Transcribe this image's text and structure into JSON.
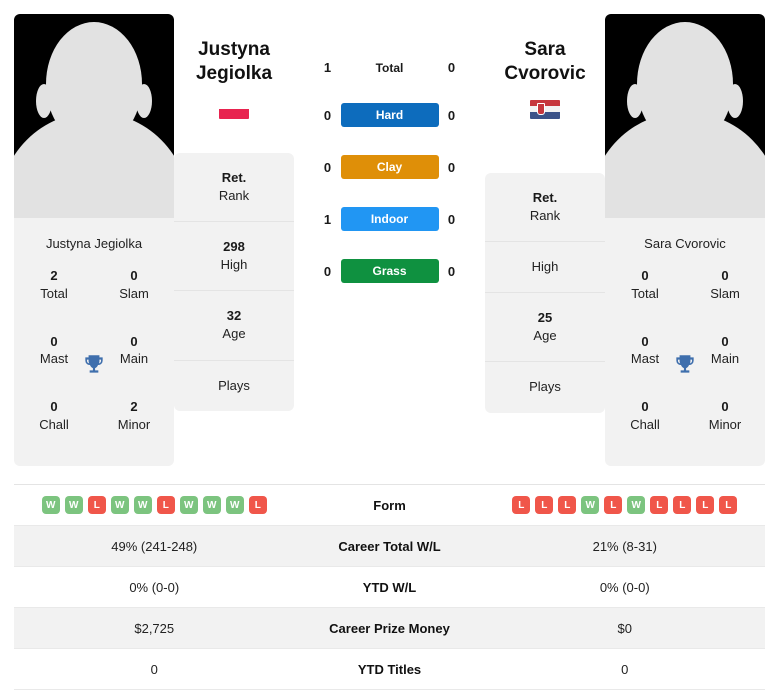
{
  "colors": {
    "hard": "#0d6cbd",
    "clay": "#df8f08",
    "indoor": "#2196f3",
    "grass": "#0f9140",
    "win": "#7cc47f",
    "loss": "#f0564a",
    "trophy": "#3f6fad"
  },
  "players": {
    "left": {
      "first_name": "Justyna",
      "last_name": "Jegiolka",
      "flag": "poland-flag",
      "photo_caption": "Justyna Jegiolka",
      "avatar": "player-avatar-placeholder",
      "titles": [
        {
          "num": "2",
          "label": "Total"
        },
        {
          "num": "0",
          "label": "Slam"
        },
        {
          "num": "0",
          "label": "Mast"
        },
        {
          "num": "0",
          "label": "Main"
        },
        {
          "num": "0",
          "label": "Chall"
        },
        {
          "num": "2",
          "label": "Minor"
        }
      ],
      "info": [
        {
          "value": "Ret.",
          "key": "Rank"
        },
        {
          "value": "298",
          "key": "High"
        },
        {
          "value": "32",
          "key": "Age"
        },
        {
          "value": "",
          "key": "Plays"
        }
      ],
      "form": [
        "W",
        "W",
        "L",
        "W",
        "W",
        "L",
        "W",
        "W",
        "W",
        "L"
      ]
    },
    "right": {
      "first_name": "Sara",
      "last_name": "Cvorovic",
      "flag": "serbia-flag",
      "photo_caption": "Sara Cvorovic",
      "avatar": "player-avatar-placeholder",
      "titles": [
        {
          "num": "0",
          "label": "Total"
        },
        {
          "num": "0",
          "label": "Slam"
        },
        {
          "num": "0",
          "label": "Mast"
        },
        {
          "num": "0",
          "label": "Main"
        },
        {
          "num": "0",
          "label": "Chall"
        },
        {
          "num": "0",
          "label": "Minor"
        }
      ],
      "info": [
        {
          "value": "Ret.",
          "key": "Rank"
        },
        {
          "value": "",
          "key": "High"
        },
        {
          "value": "25",
          "key": "Age"
        },
        {
          "value": "",
          "key": "Plays"
        }
      ],
      "form": [
        "L",
        "L",
        "L",
        "W",
        "L",
        "W",
        "L",
        "L",
        "L",
        "L"
      ]
    }
  },
  "head_to_head": [
    {
      "label": "Total",
      "left": "1",
      "right": "0",
      "style": "plain"
    },
    {
      "label": "Hard",
      "left": "0",
      "right": "0",
      "style": "hard"
    },
    {
      "label": "Clay",
      "left": "0",
      "right": "0",
      "style": "clay"
    },
    {
      "label": "Indoor",
      "left": "1",
      "right": "0",
      "style": "indoor"
    },
    {
      "label": "Grass",
      "left": "0",
      "right": "0",
      "style": "grass"
    }
  ],
  "stats_rows": [
    {
      "label": "Form",
      "left": "",
      "right": "",
      "type": "form"
    },
    {
      "label": "Career Total W/L",
      "left": "49% (241-248)",
      "right": "21% (8-31)",
      "type": "text"
    },
    {
      "label": "YTD W/L",
      "left": "0% (0-0)",
      "right": "0% (0-0)",
      "type": "text"
    },
    {
      "label": "Career Prize Money",
      "left": "$2,725",
      "right": "$0",
      "type": "text"
    },
    {
      "label": "YTD Titles",
      "left": "0",
      "right": "0",
      "type": "text"
    }
  ]
}
